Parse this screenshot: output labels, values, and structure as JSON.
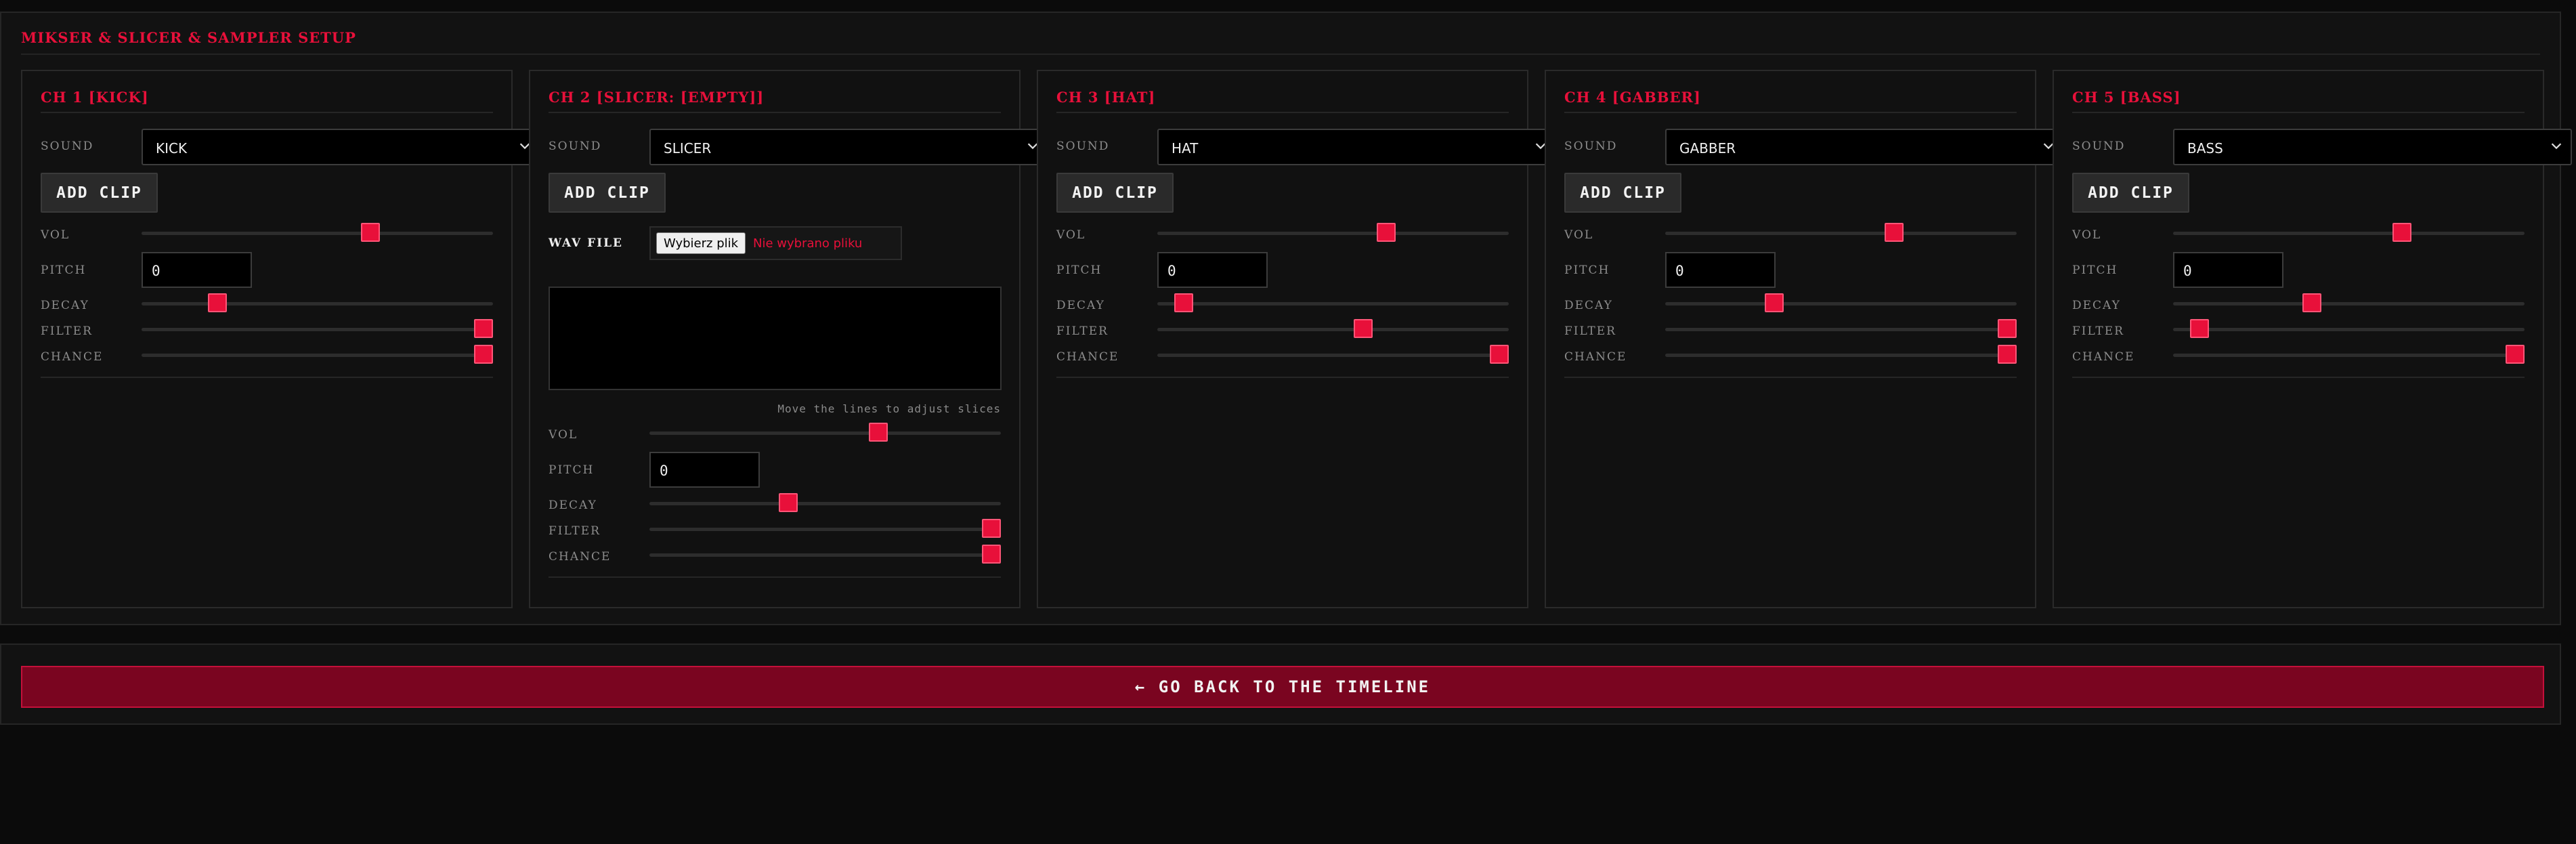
{
  "setup": {
    "title": "MIKSER & SLICER & SAMPLER SETUP"
  },
  "labels": {
    "sound": "SOUND",
    "add_clip": "ADD CLIP",
    "vol": "VOL",
    "pitch": "PITCH",
    "decay": "DECAY",
    "filter": "FILTER",
    "chance": "CHANCE",
    "wav_file": "WAV FILE"
  },
  "channels": [
    {
      "title": "CH 1 [KICK]",
      "sound": "KICK",
      "pitch": "0",
      "vol": 0.66,
      "decay": 0.2,
      "filter": 1.0,
      "chance": 1.0
    },
    {
      "title": "CH 2 [SLICER: [EMPTY]]",
      "sound": "SLICER",
      "pitch": "0",
      "vol": 0.66,
      "decay": 0.39,
      "filter": 1.0,
      "chance": 1.0,
      "file_button": "Wybierz plik",
      "file_status": "Nie wybrano pliku",
      "slice_hint": "Move the lines to adjust slices"
    },
    {
      "title": "CH 3 [HAT]",
      "sound": "HAT",
      "pitch": "0",
      "vol": 0.66,
      "decay": 0.05,
      "filter": 0.59,
      "chance": 1.0
    },
    {
      "title": "CH 4 [GABBER]",
      "sound": "GABBER",
      "pitch": "0",
      "vol": 0.66,
      "decay": 0.3,
      "filter": 1.0,
      "chance": 1.0
    },
    {
      "title": "CH 5 [BASS]",
      "sound": "BASS",
      "pitch": "0",
      "vol": 0.66,
      "decay": 0.39,
      "filter": 0.05,
      "chance": 1.0
    }
  ],
  "footer": {
    "back_label": "← GO BACK TO THE TIMELINE"
  },
  "colors": {
    "accent": "#e8103a",
    "back_button_bg": "#7a0520",
    "panel_bg": "#111111"
  }
}
